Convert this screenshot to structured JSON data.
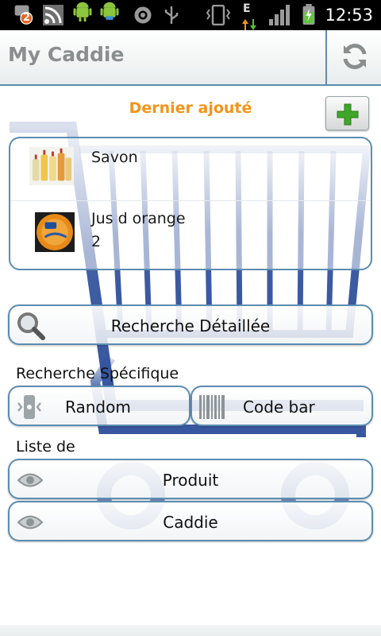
{
  "status_bar": {
    "notification_count": "2",
    "network_type": "E",
    "time": "12:53",
    "icons": [
      "notification-icon",
      "wifi-icon",
      "android-debug-icon",
      "android-icon",
      "settings-icon",
      "usb-icon",
      "vibrate-icon",
      "data-arrows-icon",
      "signal-icon",
      "battery-charging-icon"
    ]
  },
  "header": {
    "title": "My Caddie",
    "refresh_icon": "refresh-icon"
  },
  "recent": {
    "title": "Dernier ajouté",
    "add_icon": "plus-icon",
    "items": [
      {
        "name": "Savon",
        "qty": "",
        "thumb": "soap-bottles-thumb"
      },
      {
        "name": "Jus d orange",
        "qty": "2",
        "thumb": "orange-juice-thumb"
      }
    ]
  },
  "detailed_search": {
    "label": "Recherche Détaillée",
    "icon": "magnifier-icon"
  },
  "specific_search": {
    "title": "Recherche Spécifique",
    "random_label": "Random",
    "barcode_label": "Code bar"
  },
  "list_section": {
    "title": "Liste de",
    "product_label": "Produit",
    "caddie_label": "Caddie"
  },
  "colors": {
    "accent_orange": "#f2941b",
    "border_blue": "#5b8db1",
    "add_green": "#3fa62a",
    "cart_blue": "#2c4d9a"
  }
}
